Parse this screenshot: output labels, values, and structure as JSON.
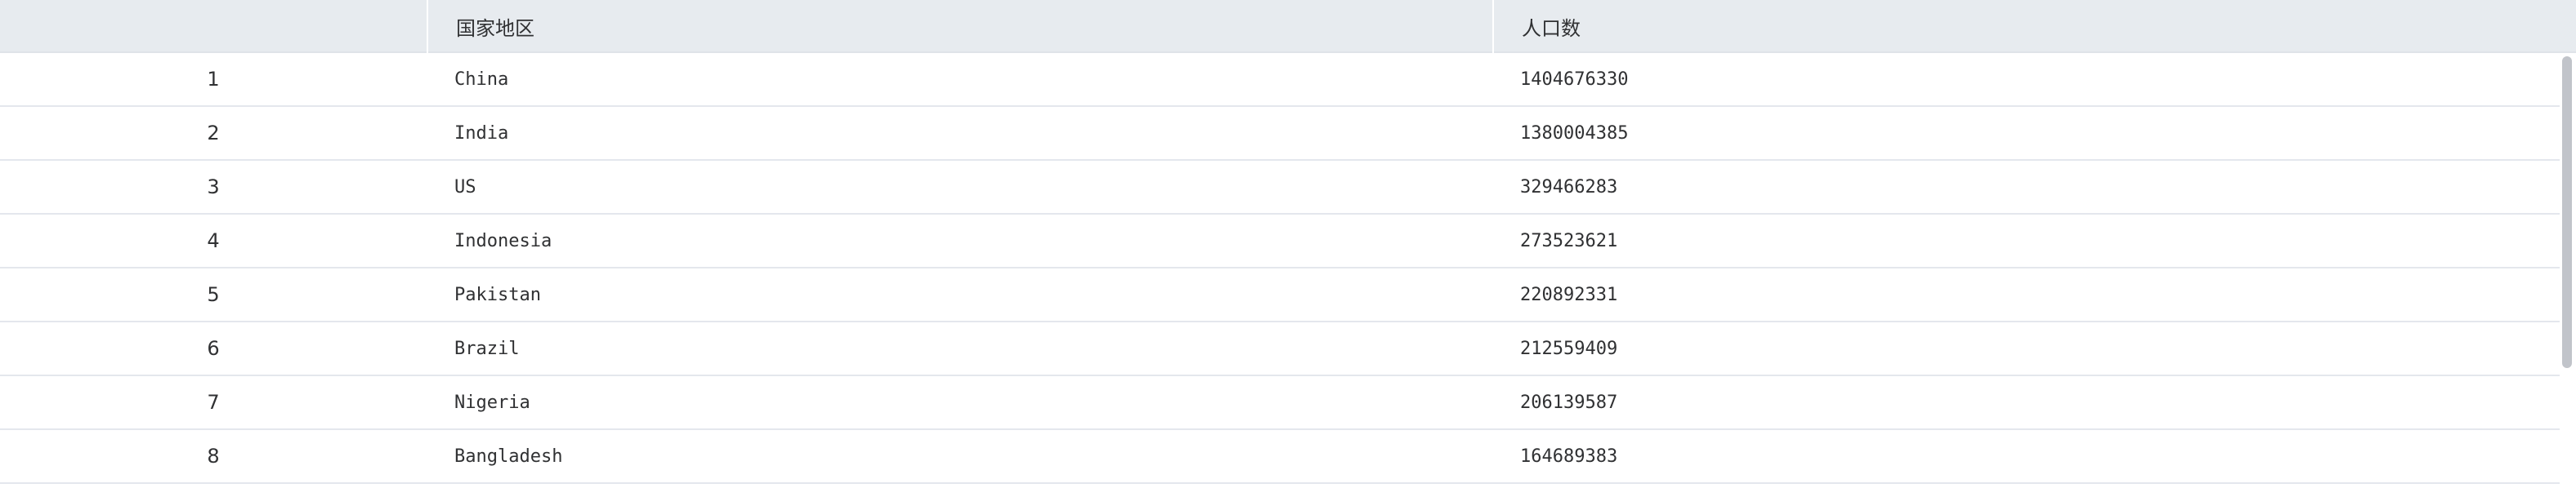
{
  "table": {
    "columns": {
      "index": "",
      "country": "国家地区",
      "population": "人口数"
    },
    "rows": [
      {
        "index": "1",
        "country": "China",
        "population": "1404676330"
      },
      {
        "index": "2",
        "country": "India",
        "population": "1380004385"
      },
      {
        "index": "3",
        "country": "US",
        "population": "329466283"
      },
      {
        "index": "4",
        "country": "Indonesia",
        "population": "273523621"
      },
      {
        "index": "5",
        "country": "Pakistan",
        "population": "220892331"
      },
      {
        "index": "6",
        "country": "Brazil",
        "population": "212559409"
      },
      {
        "index": "7",
        "country": "Nigeria",
        "population": "206139587"
      },
      {
        "index": "8",
        "country": "Bangladesh",
        "population": "164689383"
      }
    ]
  },
  "colors": {
    "header_bg": "#e7ebef",
    "row_bg": "#ffffff",
    "row_border": "#e4e7ed",
    "text": "#303133",
    "scrollbar_thumb": "#c1c4ca"
  }
}
